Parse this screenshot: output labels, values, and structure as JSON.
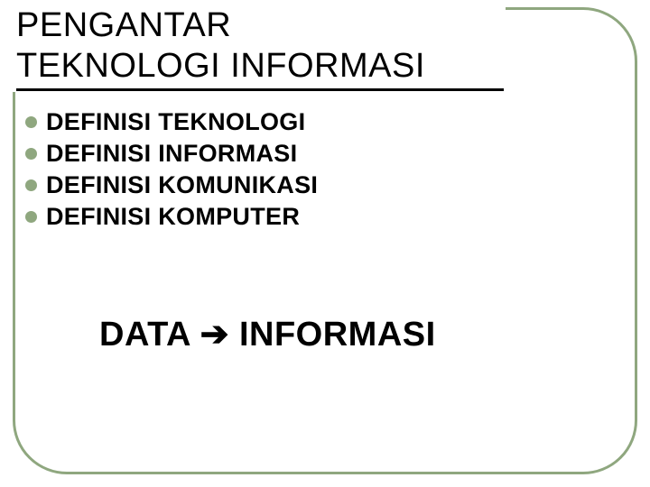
{
  "title_line1": "PENGANTAR",
  "title_line2": "TEKNOLOGI INFORMASI",
  "bullets": [
    "DEFINISI TEKNOLOGI",
    "DEFINISI INFORMASI",
    "DEFINISI KOMUNIKASI",
    "DEFINISI KOMPUTER"
  ],
  "footer_left": "DATA",
  "footer_arrow": "➔",
  "footer_right": "INFORMASI"
}
